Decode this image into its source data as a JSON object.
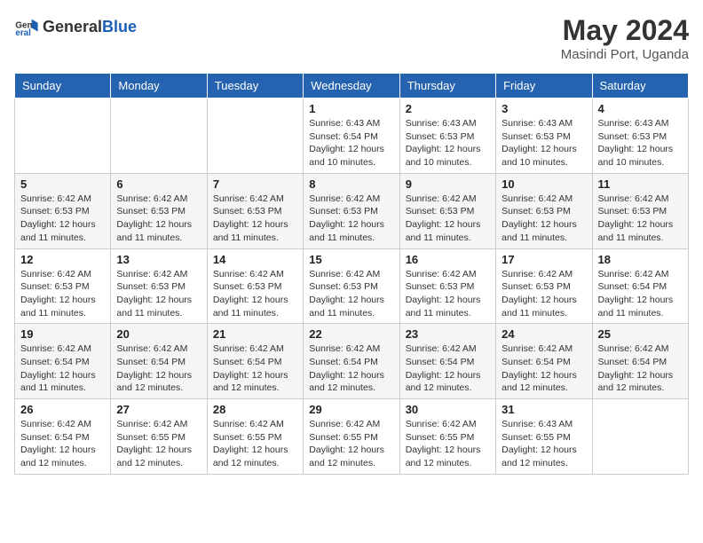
{
  "header": {
    "logo_general": "General",
    "logo_blue": "Blue",
    "month_title": "May 2024",
    "location": "Masindi Port, Uganda"
  },
  "weekdays": [
    "Sunday",
    "Monday",
    "Tuesday",
    "Wednesday",
    "Thursday",
    "Friday",
    "Saturday"
  ],
  "weeks": [
    [
      {
        "day": "",
        "info": ""
      },
      {
        "day": "",
        "info": ""
      },
      {
        "day": "",
        "info": ""
      },
      {
        "day": "1",
        "info": "Sunrise: 6:43 AM\nSunset: 6:54 PM\nDaylight: 12 hours and 10 minutes."
      },
      {
        "day": "2",
        "info": "Sunrise: 6:43 AM\nSunset: 6:53 PM\nDaylight: 12 hours and 10 minutes."
      },
      {
        "day": "3",
        "info": "Sunrise: 6:43 AM\nSunset: 6:53 PM\nDaylight: 12 hours and 10 minutes."
      },
      {
        "day": "4",
        "info": "Sunrise: 6:43 AM\nSunset: 6:53 PM\nDaylight: 12 hours and 10 minutes."
      }
    ],
    [
      {
        "day": "5",
        "info": "Sunrise: 6:42 AM\nSunset: 6:53 PM\nDaylight: 12 hours and 11 minutes."
      },
      {
        "day": "6",
        "info": "Sunrise: 6:42 AM\nSunset: 6:53 PM\nDaylight: 12 hours and 11 minutes."
      },
      {
        "day": "7",
        "info": "Sunrise: 6:42 AM\nSunset: 6:53 PM\nDaylight: 12 hours and 11 minutes."
      },
      {
        "day": "8",
        "info": "Sunrise: 6:42 AM\nSunset: 6:53 PM\nDaylight: 12 hours and 11 minutes."
      },
      {
        "day": "9",
        "info": "Sunrise: 6:42 AM\nSunset: 6:53 PM\nDaylight: 12 hours and 11 minutes."
      },
      {
        "day": "10",
        "info": "Sunrise: 6:42 AM\nSunset: 6:53 PM\nDaylight: 12 hours and 11 minutes."
      },
      {
        "day": "11",
        "info": "Sunrise: 6:42 AM\nSunset: 6:53 PM\nDaylight: 12 hours and 11 minutes."
      }
    ],
    [
      {
        "day": "12",
        "info": "Sunrise: 6:42 AM\nSunset: 6:53 PM\nDaylight: 12 hours and 11 minutes."
      },
      {
        "day": "13",
        "info": "Sunrise: 6:42 AM\nSunset: 6:53 PM\nDaylight: 12 hours and 11 minutes."
      },
      {
        "day": "14",
        "info": "Sunrise: 6:42 AM\nSunset: 6:53 PM\nDaylight: 12 hours and 11 minutes."
      },
      {
        "day": "15",
        "info": "Sunrise: 6:42 AM\nSunset: 6:53 PM\nDaylight: 12 hours and 11 minutes."
      },
      {
        "day": "16",
        "info": "Sunrise: 6:42 AM\nSunset: 6:53 PM\nDaylight: 12 hours and 11 minutes."
      },
      {
        "day": "17",
        "info": "Sunrise: 6:42 AM\nSunset: 6:53 PM\nDaylight: 12 hours and 11 minutes."
      },
      {
        "day": "18",
        "info": "Sunrise: 6:42 AM\nSunset: 6:54 PM\nDaylight: 12 hours and 11 minutes."
      }
    ],
    [
      {
        "day": "19",
        "info": "Sunrise: 6:42 AM\nSunset: 6:54 PM\nDaylight: 12 hours and 11 minutes."
      },
      {
        "day": "20",
        "info": "Sunrise: 6:42 AM\nSunset: 6:54 PM\nDaylight: 12 hours and 12 minutes."
      },
      {
        "day": "21",
        "info": "Sunrise: 6:42 AM\nSunset: 6:54 PM\nDaylight: 12 hours and 12 minutes."
      },
      {
        "day": "22",
        "info": "Sunrise: 6:42 AM\nSunset: 6:54 PM\nDaylight: 12 hours and 12 minutes."
      },
      {
        "day": "23",
        "info": "Sunrise: 6:42 AM\nSunset: 6:54 PM\nDaylight: 12 hours and 12 minutes."
      },
      {
        "day": "24",
        "info": "Sunrise: 6:42 AM\nSunset: 6:54 PM\nDaylight: 12 hours and 12 minutes."
      },
      {
        "day": "25",
        "info": "Sunrise: 6:42 AM\nSunset: 6:54 PM\nDaylight: 12 hours and 12 minutes."
      }
    ],
    [
      {
        "day": "26",
        "info": "Sunrise: 6:42 AM\nSunset: 6:54 PM\nDaylight: 12 hours and 12 minutes."
      },
      {
        "day": "27",
        "info": "Sunrise: 6:42 AM\nSunset: 6:55 PM\nDaylight: 12 hours and 12 minutes."
      },
      {
        "day": "28",
        "info": "Sunrise: 6:42 AM\nSunset: 6:55 PM\nDaylight: 12 hours and 12 minutes."
      },
      {
        "day": "29",
        "info": "Sunrise: 6:42 AM\nSunset: 6:55 PM\nDaylight: 12 hours and 12 minutes."
      },
      {
        "day": "30",
        "info": "Sunrise: 6:42 AM\nSunset: 6:55 PM\nDaylight: 12 hours and 12 minutes."
      },
      {
        "day": "31",
        "info": "Sunrise: 6:43 AM\nSunset: 6:55 PM\nDaylight: 12 hours and 12 minutes."
      },
      {
        "day": "",
        "info": ""
      }
    ]
  ]
}
